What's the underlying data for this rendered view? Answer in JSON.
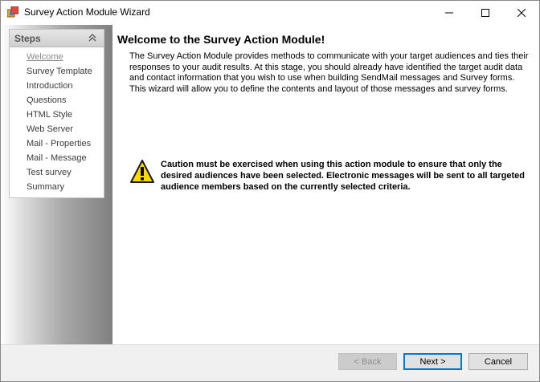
{
  "window": {
    "title": "Survey Action Module Wizard"
  },
  "icons": {
    "app": "wizard-app-icon",
    "minimize": "minimize-icon",
    "maximize": "maximize-icon",
    "close": "close-icon",
    "collapse": "double-chevron-up-icon",
    "warning": "warning-triangle-icon"
  },
  "colors": {
    "accent": "#0078d7",
    "warning_fill": "#ffd800"
  },
  "sidebar": {
    "title": "Steps",
    "items": [
      {
        "label": "Welcome",
        "active": true
      },
      {
        "label": "Survey Template",
        "active": false
      },
      {
        "label": "Introduction",
        "active": false
      },
      {
        "label": "Questions",
        "active": false
      },
      {
        "label": "HTML Style",
        "active": false
      },
      {
        "label": "Web Server",
        "active": false
      },
      {
        "label": "Mail - Properties",
        "active": false
      },
      {
        "label": "Mail - Message",
        "active": false
      },
      {
        "label": "Test survey",
        "active": false
      },
      {
        "label": "Summary",
        "active": false
      }
    ]
  },
  "main": {
    "title": "Welcome to the Survey Action Module!",
    "description": "The Survey Action Module provides methods to communicate with your target audiences and ties their responses to your audit results. At this stage, you should already have identified the target audit data and contact information that you wish to use when building SendMail messages and Survey forms. This wizard will allow you to define the contents and layout of those messages and survey forms.",
    "caution": "Caution must be exercised when using this action module to ensure that only the desired audiences have been selected. Electronic messages will be sent to all targeted audience members based on the currently selected criteria."
  },
  "footer": {
    "back_label": "< Back",
    "next_label": "Next >",
    "cancel_label": "Cancel",
    "back_enabled": false
  }
}
